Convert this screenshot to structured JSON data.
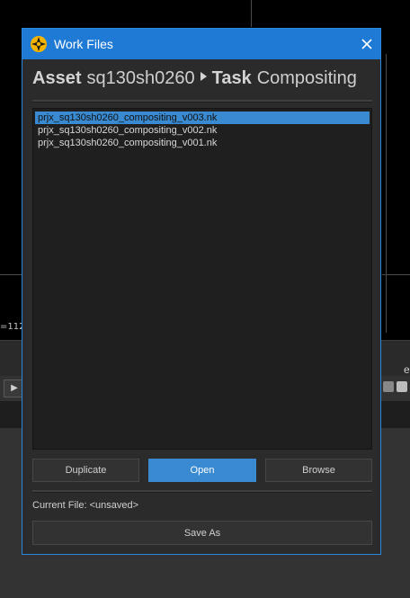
{
  "background": {
    "coord_text": "=112"
  },
  "dialog": {
    "title": "Work Files",
    "header": {
      "asset_label": "Asset",
      "asset_value": "sq130sh0260",
      "task_label": "Task",
      "task_value": "Compositing"
    },
    "files": [
      {
        "name": "prjx_sq130sh0260_compositing_v003.nk",
        "selected": true
      },
      {
        "name": "prjx_sq130sh0260_compositing_v002.nk",
        "selected": false
      },
      {
        "name": "prjx_sq130sh0260_compositing_v001.nk",
        "selected": false
      }
    ],
    "buttons": {
      "duplicate": "Duplicate",
      "open": "Open",
      "browse": "Browse",
      "save_as": "Save As"
    },
    "current_file_label": "Current File:",
    "current_file_value": "<unsaved>"
  },
  "colors": {
    "accent": "#1f7ad6",
    "selection": "#3a8ad1",
    "dialog_bg": "#2b2b2b",
    "list_bg": "#1f1f1f"
  },
  "icons": {
    "app": "app-logo-icon",
    "close": "close-icon",
    "separator": "chevron-right-icon"
  }
}
